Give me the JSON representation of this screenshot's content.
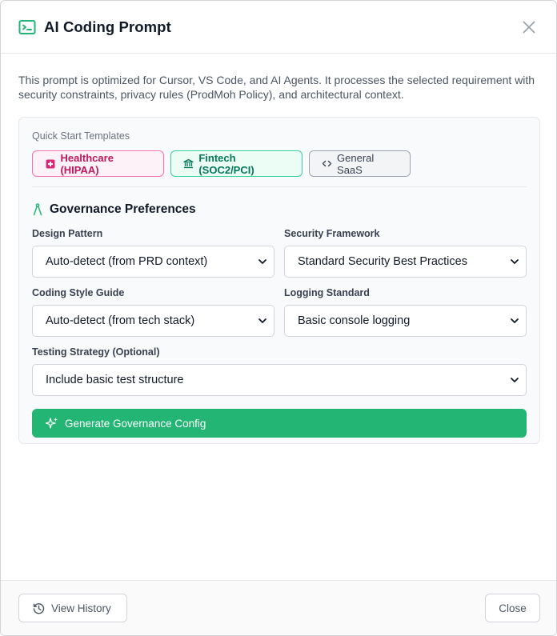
{
  "modal": {
    "title": "AI Coding Prompt",
    "description": "This prompt is optimized for Cursor, VS Code, and AI Agents. It processes the selected requirement with security constraints, privacy rules (ProdMoh Policy), and architectural context."
  },
  "templates": {
    "label": "Quick Start Templates",
    "items": [
      {
        "label": "Healthcare (HIPAA)",
        "icon": "medical-cross-icon",
        "color": "#be185d"
      },
      {
        "label": "Fintech (SOC2/PCI)",
        "icon": "bank-icon",
        "color": "#047857"
      },
      {
        "label": "General SaaS",
        "icon": "code-icon",
        "color": "#374151"
      }
    ]
  },
  "governance": {
    "title": "Governance Preferences",
    "fields": {
      "design_pattern": {
        "label": "Design Pattern",
        "value": "Auto-detect (from PRD context)"
      },
      "security_framework": {
        "label": "Security Framework",
        "value": "Standard Security Best Practices"
      },
      "coding_style": {
        "label": "Coding Style Guide",
        "value": "Auto-detect (from tech stack)"
      },
      "logging_standard": {
        "label": "Logging Standard",
        "value": "Basic console logging"
      },
      "testing_strategy": {
        "label": "Testing Strategy (Optional)",
        "value": "Include basic test structure"
      }
    },
    "generate_label": "Generate Governance Config"
  },
  "footer": {
    "history_label": "View History",
    "close_label": "Close"
  },
  "colors": {
    "accent": "#22b573",
    "text_primary": "#111827",
    "text_muted": "#4b5563"
  }
}
